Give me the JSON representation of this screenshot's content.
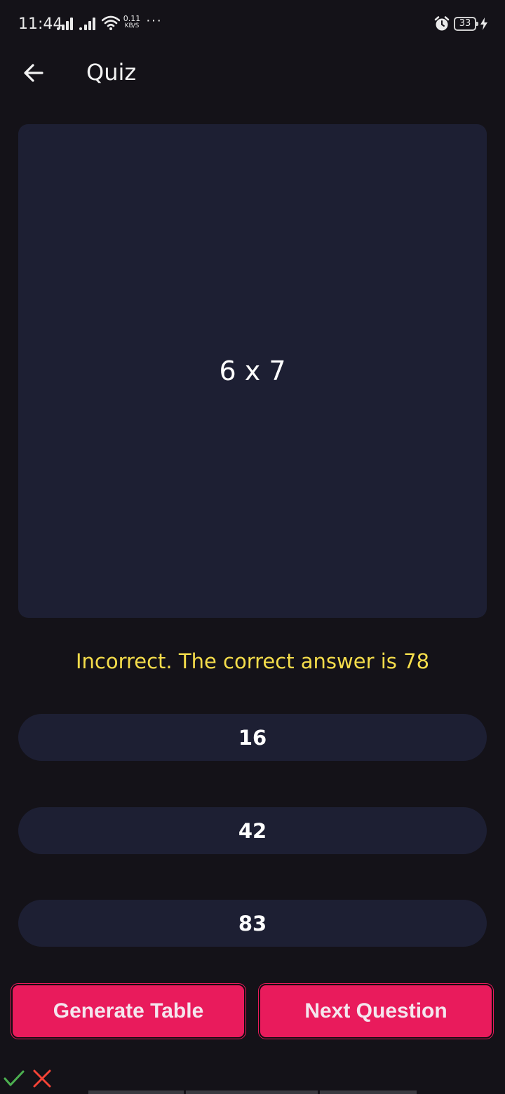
{
  "status_bar": {
    "time": "11:44",
    "net_speed_value": "0.11",
    "net_speed_unit": "KB/S",
    "more": "···",
    "battery": "33"
  },
  "app_bar": {
    "title": "Quiz"
  },
  "question": {
    "text": "6 x 7"
  },
  "feedback": {
    "text": "Incorrect. The correct answer is 78"
  },
  "options": [
    {
      "label": "16"
    },
    {
      "label": "42"
    },
    {
      "label": "83"
    }
  ],
  "actions": {
    "generate_table": "Generate Table",
    "next_question": "Next Question"
  },
  "colors": {
    "background": "#141218",
    "card": "#1d1f33",
    "feedback": "#f5dd4b",
    "accent": "#e91b5c",
    "check": "#4caf50",
    "cross": "#f44336"
  },
  "icons": [
    "back-arrow-icon",
    "alarm-icon",
    "battery-icon",
    "charging-bolt-icon",
    "check-icon",
    "cross-icon"
  ]
}
